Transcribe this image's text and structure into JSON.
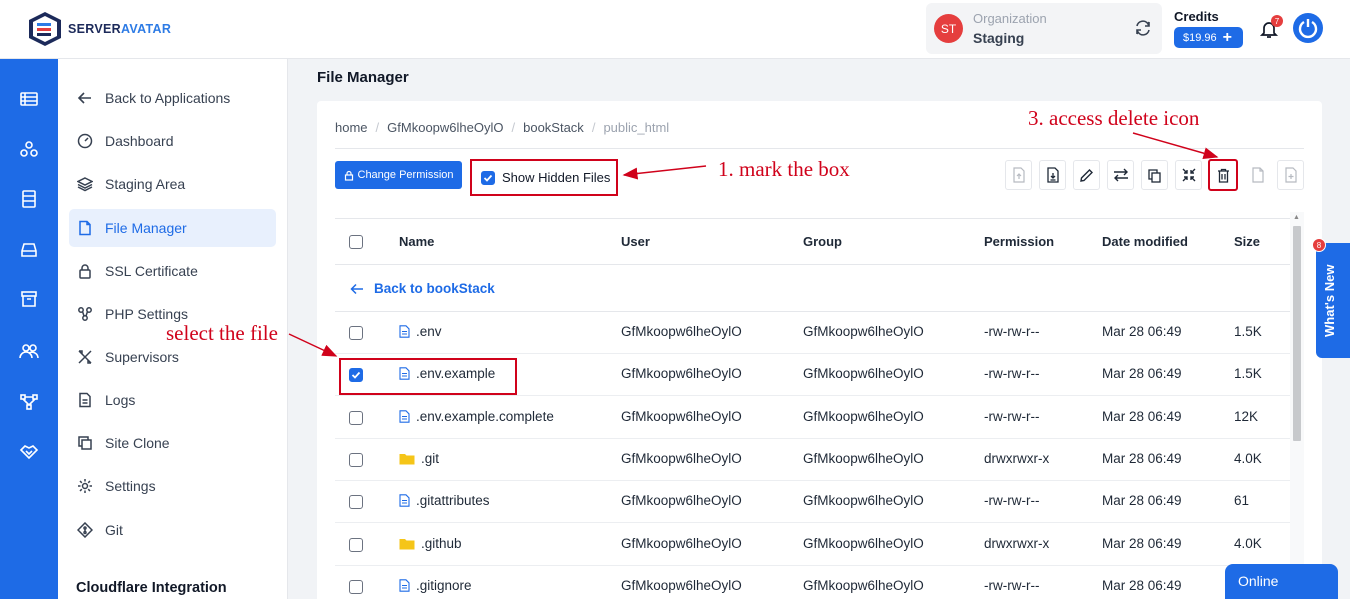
{
  "brand": {
    "name_part1": "SERVER",
    "name_part2": "AVATAR",
    "primary": "#1e6be6",
    "annotation_color": "#d0021b"
  },
  "header": {
    "org_initials": "ST",
    "org_label": "Organization",
    "org_name": "Staging",
    "credits_label": "Credits",
    "credits_value": "$19.96",
    "credits_add": "+",
    "notifications_count": "7"
  },
  "rail_icons": [
    "list-icon",
    "apps-icon",
    "server-icon",
    "storage-icon",
    "archive-icon",
    "team-icon",
    "network-icon",
    "handshake-icon"
  ],
  "sidebar": {
    "items": [
      {
        "label": "Back to Applications",
        "icon": "arrow-left-icon"
      },
      {
        "label": "Dashboard",
        "icon": "gauge-icon"
      },
      {
        "label": "Staging Area",
        "icon": "layers-icon"
      },
      {
        "label": "File Manager",
        "icon": "file-icon",
        "active": true
      },
      {
        "label": "SSL Certificate",
        "icon": "lock-icon"
      },
      {
        "label": "PHP Settings",
        "icon": "php-icon"
      },
      {
        "label": "Supervisors",
        "icon": "tools-icon"
      },
      {
        "label": "Logs",
        "icon": "document-icon"
      },
      {
        "label": "Site Clone",
        "icon": "copy-icon"
      },
      {
        "label": "Settings",
        "icon": "gear-icon"
      },
      {
        "label": "Git",
        "icon": "git-icon"
      }
    ],
    "section_title": "Cloudflare Integration"
  },
  "main": {
    "page_title": "File Manager",
    "breadcrumb": [
      "home",
      "GfMkoopw6lheOylO",
      "bookStack",
      "public_html"
    ],
    "change_permission": "Change Permission",
    "show_hidden": "Show Hidden Files",
    "toolbar": [
      "upload-file-icon",
      "download-file-icon",
      "edit-icon",
      "move-icon",
      "copy-icon",
      "compress-icon",
      "delete-icon",
      "new-file-icon",
      "new-document-icon"
    ],
    "table": {
      "headers": {
        "name": "Name",
        "user": "User",
        "group": "Group",
        "permission": "Permission",
        "modified": "Date modified",
        "size": "Size"
      },
      "back_link": "Back to bookStack",
      "rows": [
        {
          "name": ".env",
          "type": "file",
          "user": "GfMkoopw6lheOylO",
          "group": "GfMkoopw6lheOylO",
          "perm": "-rw-rw-r--",
          "date": "Mar 28 06:49",
          "size": "1.5K",
          "checked": false
        },
        {
          "name": ".env.example",
          "type": "file",
          "user": "GfMkoopw6lheOylO",
          "group": "GfMkoopw6lheOylO",
          "perm": "-rw-rw-r--",
          "date": "Mar 28 06:49",
          "size": "1.5K",
          "checked": true
        },
        {
          "name": ".env.example.complete",
          "type": "file",
          "user": "GfMkoopw6lheOylO",
          "group": "GfMkoopw6lheOylO",
          "perm": "-rw-rw-r--",
          "date": "Mar 28 06:49",
          "size": "12K",
          "checked": false
        },
        {
          "name": ".git",
          "type": "folder",
          "user": "GfMkoopw6lheOylO",
          "group": "GfMkoopw6lheOylO",
          "perm": "drwxrwxr-x",
          "date": "Mar 28 06:49",
          "size": "4.0K",
          "checked": false
        },
        {
          "name": ".gitattributes",
          "type": "file",
          "user": "GfMkoopw6lheOylO",
          "group": "GfMkoopw6lheOylO",
          "perm": "-rw-rw-r--",
          "date": "Mar 28 06:49",
          "size": "61",
          "checked": false
        },
        {
          "name": ".github",
          "type": "folder",
          "user": "GfMkoopw6lheOylO",
          "group": "GfMkoopw6lheOylO",
          "perm": "drwxrwxr-x",
          "date": "Mar 28 06:49",
          "size": "4.0K",
          "checked": false
        },
        {
          "name": ".gitignore",
          "type": "file",
          "user": "GfMkoopw6lheOylO",
          "group": "GfMkoopw6lheOylO",
          "perm": "-rw-rw-r--",
          "date": "Mar 28 06:49",
          "size": "61",
          "checked": false
        }
      ]
    }
  },
  "annotations": {
    "mark_box": "1. mark the box",
    "select_file": "select the file",
    "delete_icon": "3. access delete icon"
  },
  "whats_new": {
    "label": "What's New",
    "badge": "8"
  },
  "online": "Online"
}
